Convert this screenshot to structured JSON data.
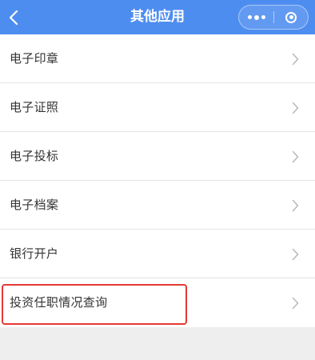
{
  "navbar": {
    "title": "其他应用",
    "background": "#4e8df0",
    "back_icon": "chevron-left-icon",
    "more_icon": "more-dots-icon",
    "close_icon": "target-close-icon"
  },
  "list": {
    "items": [
      {
        "label": "电子印章",
        "icon": "chevron-right-icon"
      },
      {
        "label": "电子证照",
        "icon": "chevron-right-icon"
      },
      {
        "label": "电子投标",
        "icon": "chevron-right-icon"
      },
      {
        "label": "电子档案",
        "icon": "chevron-right-icon"
      },
      {
        "label": "银行开户",
        "icon": "chevron-right-icon"
      },
      {
        "label": "投资任职情况查询",
        "icon": "chevron-right-icon",
        "highlighted": true
      }
    ]
  },
  "colors": {
    "accent": "#4e8df0",
    "highlight": "#e53935",
    "page_background": "#eeeeee"
  }
}
